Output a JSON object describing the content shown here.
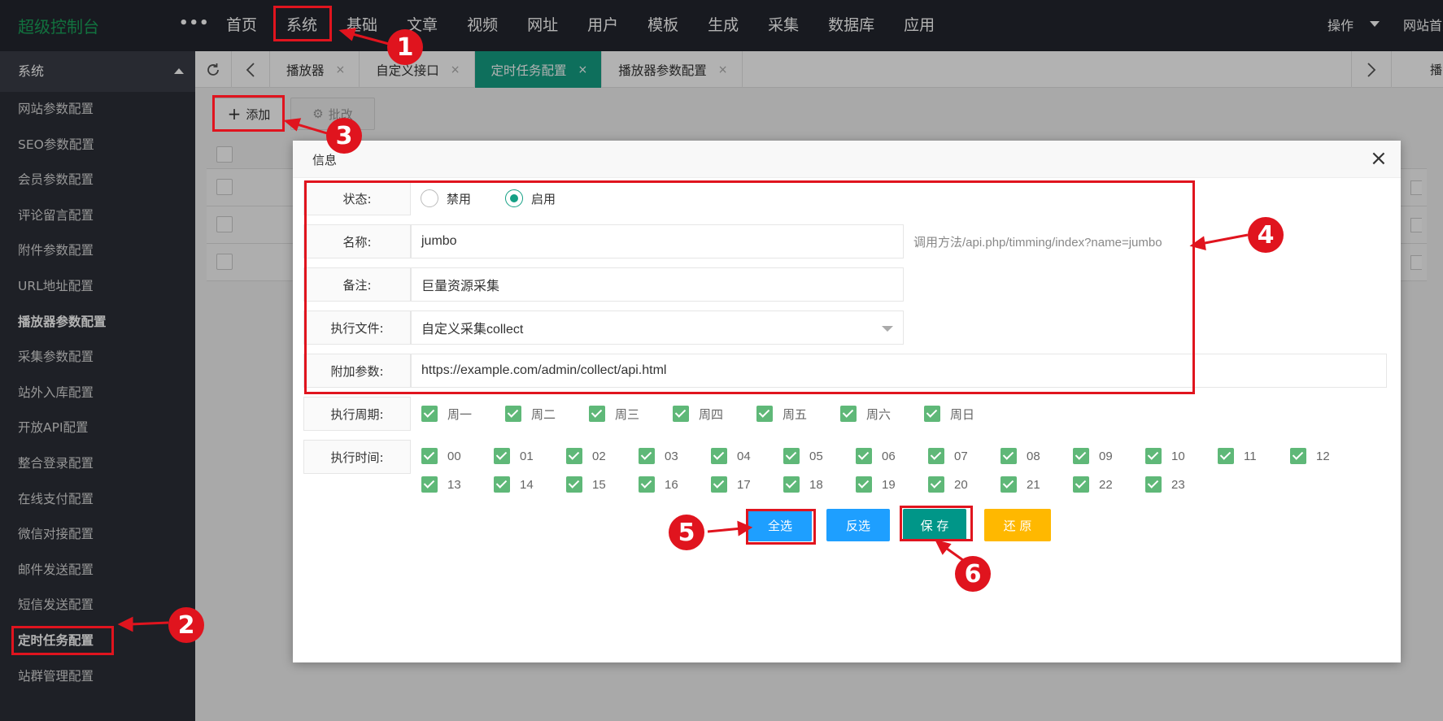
{
  "app": {
    "title": "超级控制台",
    "more": "•••"
  },
  "topnav": [
    "首页",
    "系统",
    "基础",
    "文章",
    "视频",
    "网址",
    "用户",
    "模板",
    "生成",
    "采集",
    "数据库",
    "应用"
  ],
  "top_right": {
    "operate": "操作",
    "site_home": "网站首页"
  },
  "sidebar": {
    "header": "系统",
    "items": [
      "网站参数配置",
      "SEO参数配置",
      "会员参数配置",
      "评论留言配置",
      "附件参数配置",
      "URL地址配置",
      "播放器参数配置",
      "采集参数配置",
      "站外入库配置",
      "开放API配置",
      "整合登录配置",
      "在线支付配置",
      "微信对接配置",
      "邮件发送配置",
      "短信发送配置",
      "定时任务配置",
      "站群管理配置"
    ]
  },
  "tabs": [
    {
      "label": "播放器",
      "active": false
    },
    {
      "label": "自定义接口",
      "active": false
    },
    {
      "label": "定时任务配置",
      "active": true
    },
    {
      "label": "播放器参数配置",
      "active": false
    }
  ],
  "tab_close": "×",
  "tab_overflow": "播",
  "toolbar": {
    "add": "添加",
    "add_icon": "+",
    "batch": "批改"
  },
  "modal": {
    "title": "信息",
    "close": "×",
    "status": {
      "label": "状态:",
      "options": [
        "禁用",
        "启用"
      ],
      "selected": "启用"
    },
    "name": {
      "label": "名称:",
      "value": "jumbo",
      "hint": "调用方法/api.php/timming/index?name=jumbo"
    },
    "remark": {
      "label": "备注:",
      "value": "巨量资源采集"
    },
    "file": {
      "label": "执行文件:",
      "value": "自定义采集collect"
    },
    "params": {
      "label": "附加参数:",
      "value": "https://example.com/admin/collect/api.html"
    },
    "weekdays": {
      "label": "执行周期:",
      "items": [
        "周一",
        "周二",
        "周三",
        "周四",
        "周五",
        "周六",
        "周日"
      ]
    },
    "hours": {
      "label": "执行时间:",
      "items": [
        "00",
        "01",
        "02",
        "03",
        "04",
        "05",
        "06",
        "07",
        "08",
        "09",
        "10",
        "11",
        "12",
        "13",
        "14",
        "15",
        "16",
        "17",
        "18",
        "19",
        "20",
        "21",
        "22",
        "23"
      ]
    },
    "buttons": {
      "select_all": "全选",
      "invert": "反选",
      "save": "保 存",
      "reset": "还 原"
    }
  },
  "annotations": [
    "1",
    "2",
    "3",
    "4",
    "5",
    "6"
  ],
  "colors": {
    "brand_green": "#19a35a",
    "tab_active": "#15a085",
    "check_green": "#5fb878",
    "btn_blue": "#1e9fff",
    "btn_yellow": "#ffb800",
    "annotation_red": "#e0141e",
    "topbar": "#23262e",
    "sidebar": "#2b2e37"
  }
}
